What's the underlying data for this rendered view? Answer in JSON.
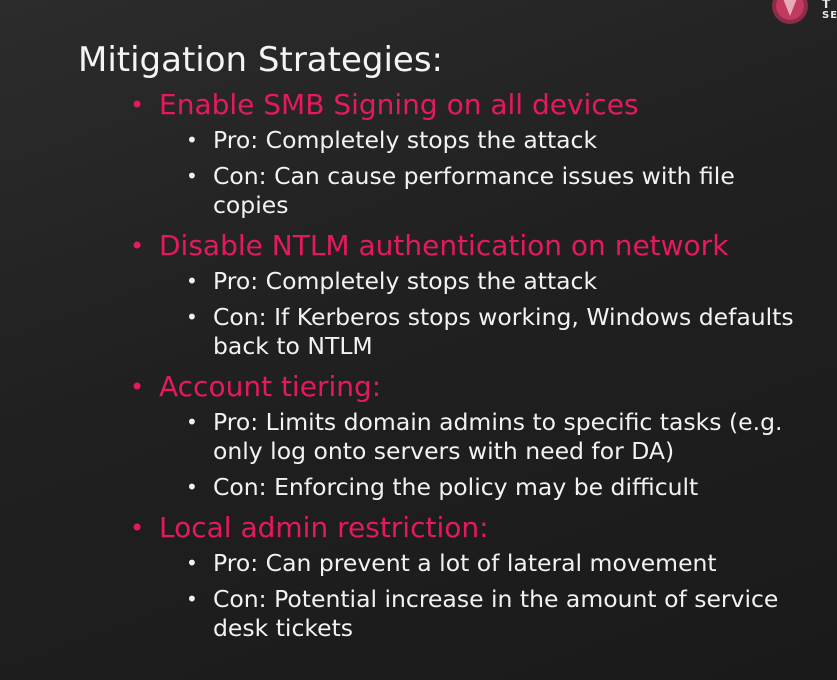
{
  "slide": {
    "title": "Mitigation Strategies:",
    "logo_text_top": "T",
    "logo_text_bottom": "SE",
    "items": [
      {
        "heading": "Enable SMB Signing on all devices",
        "points": [
          "Pro: Completely stops the attack",
          "Con: Can cause performance issues with file copies"
        ]
      },
      {
        "heading": "Disable NTLM authentication on network",
        "points": [
          "Pro: Completely stops the attack",
          "Con: If Kerberos stops working, Windows defaults back to NTLM"
        ]
      },
      {
        "heading": "Account tiering:",
        "points": [
          "Pro: Limits domain admins to specific tasks (e.g. only log onto servers with need for DA)",
          "Con: Enforcing the policy may be difficult"
        ]
      },
      {
        "heading": "Local admin restriction:",
        "points": [
          "Pro: Can prevent a lot of lateral movement",
          "Con: Potential increase in the amount of service desk tickets"
        ]
      }
    ]
  },
  "colors": {
    "accent": "#e5195f",
    "text": "#f2f2f2",
    "background": "#222222"
  }
}
